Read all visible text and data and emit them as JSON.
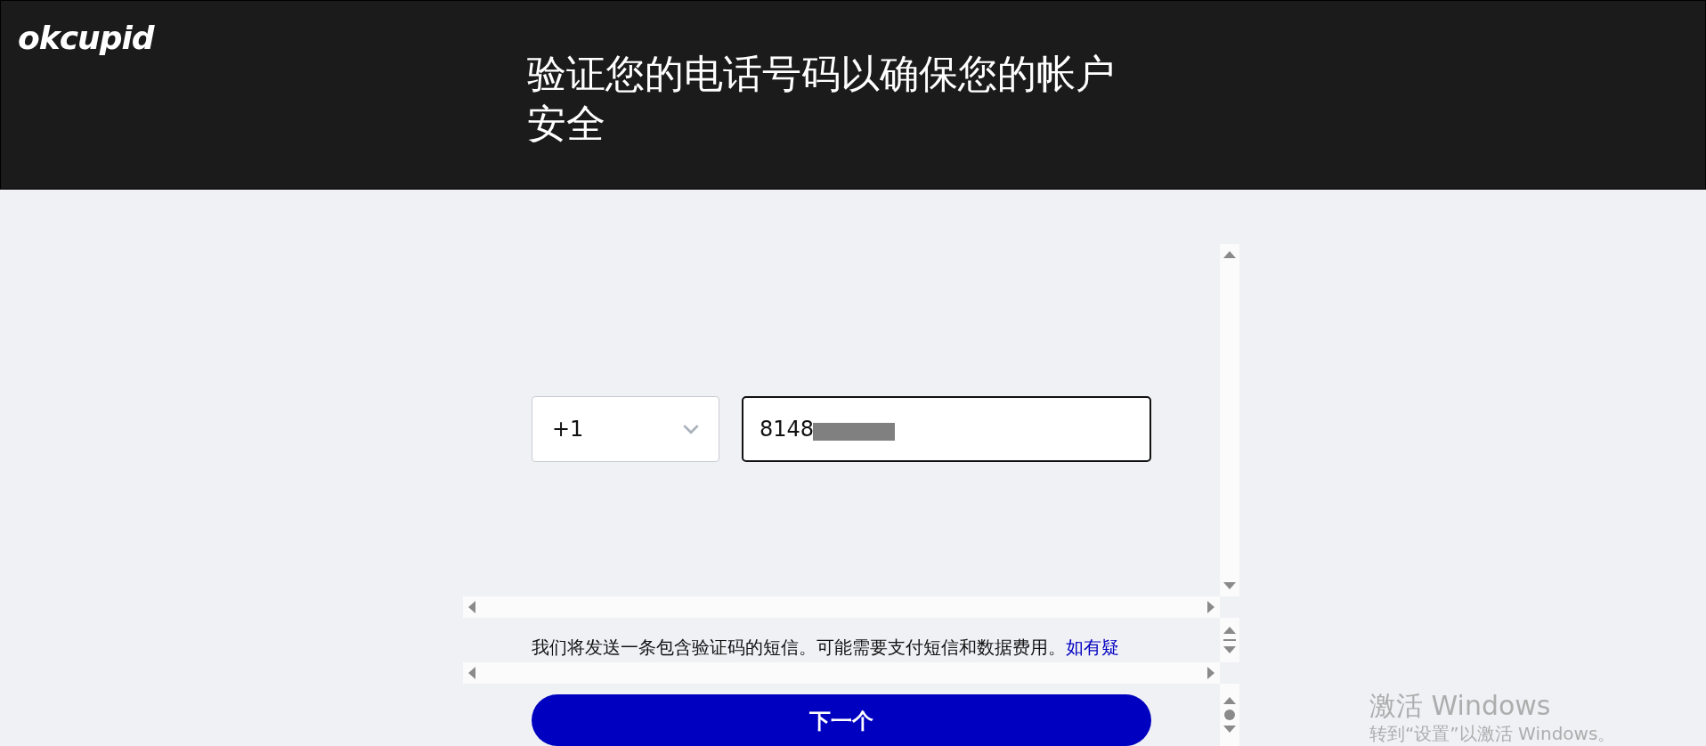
{
  "header": {
    "logo": "okcupid",
    "title": "验证您的电话号码以确保您的帐户安全"
  },
  "form": {
    "country_code": {
      "value": "+1"
    },
    "phone": {
      "value": "8148",
      "redacted": true,
      "focused": true
    }
  },
  "notice": {
    "text": "我们将发送一条包含验证码的短信。可能需要支付短信和数据费用。",
    "link": "如有疑"
  },
  "next_button": {
    "label": "下一个"
  },
  "watermark": {
    "title": "激活 Windows",
    "subtitle": "转到“设置”以激活 Windows。"
  }
}
